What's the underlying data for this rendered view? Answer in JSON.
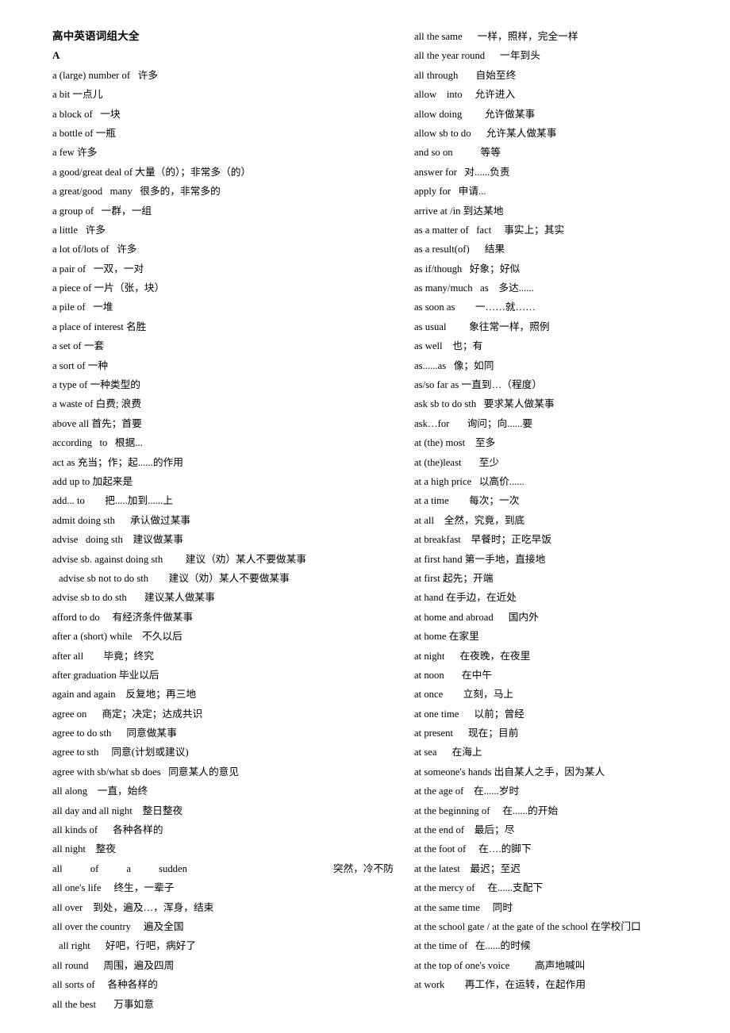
{
  "document": {
    "title": "高中英语词组大全",
    "section_letter": "A",
    "background_color": "#ffffff",
    "text_color": "#000000"
  },
  "left_column": [
    {
      "term": "a (large) number of",
      "gloss": "许多",
      "sep": "   "
    },
    {
      "term": "a bit",
      "gloss": "一点儿",
      "sep": " "
    },
    {
      "term": "a block of",
      "gloss": "一块",
      "sep": "   "
    },
    {
      "term": "a bottle of",
      "gloss": "一瓶",
      "sep": " "
    },
    {
      "term": "a few",
      "gloss": "许多",
      "sep": " "
    },
    {
      "term": "a good/great deal of",
      "gloss": "大量（的）；非常多（的）",
      "sep": " "
    },
    {
      "term": "a great/good   many",
      "gloss": "很多的，非常多的",
      "sep": "   "
    },
    {
      "term": "a group of",
      "gloss": "一群，一组",
      "sep": "   "
    },
    {
      "term": "a little",
      "gloss": "许多",
      "sep": "   "
    },
    {
      "term": "a lot of/lots of",
      "gloss": "许多",
      "sep": "   "
    },
    {
      "term": "a pair of",
      "gloss": "一双，一对",
      "sep": "   "
    },
    {
      "term": "a piece of",
      "gloss": "一片（张，块）",
      "sep": " "
    },
    {
      "term": "a pile of",
      "gloss": "一堆",
      "sep": "   "
    },
    {
      "term": "a place of interest",
      "gloss": "名胜",
      "sep": " "
    },
    {
      "term": "a set of",
      "gloss": "一套",
      "sep": " "
    },
    {
      "term": "a sort of",
      "gloss": "一种",
      "sep": " "
    },
    {
      "term": "a type of",
      "gloss": "一种类型的",
      "sep": " "
    },
    {
      "term": "a waste of",
      "gloss": "白费; 浪费",
      "sep": " "
    },
    {
      "term": "above all",
      "gloss": "首先；首要",
      "sep": " "
    },
    {
      "term": "according   to",
      "gloss": "根据...",
      "sep": "   "
    },
    {
      "term": "act as",
      "gloss": "充当；作；起......的作用",
      "sep": " "
    },
    {
      "term": "add up to",
      "gloss": "加起来是",
      "sep": " "
    },
    {
      "term": "add... to",
      "gloss": "把.....加到......上",
      "sep": "        "
    },
    {
      "term": "admit doing sth",
      "gloss": "承认做过某事",
      "sep": "      "
    },
    {
      "term": "advise   doing sth",
      "gloss": "建议做某事",
      "sep": "    "
    },
    {
      "term": "advise sb. against doing sth",
      "gloss": "建议（劝）某人不要做某事",
      "sep": "         "
    },
    {
      "term": "advise sb not to do sth",
      "gloss": "建议（劝）某人不要做某事",
      "sep": "        ",
      "indent": true
    },
    {
      "term": "advise sb to do sth",
      "gloss": "建议某人做某事",
      "sep": "       "
    },
    {
      "term": "afford to do",
      "gloss": "有经济条件做某事",
      "sep": "     "
    },
    {
      "term": "after a (short) while",
      "gloss": "不久以后",
      "sep": "    "
    },
    {
      "term": "after all",
      "gloss": "毕竟；终究",
      "sep": "        "
    },
    {
      "term": "after graduation",
      "gloss": "毕业以后",
      "sep": " "
    },
    {
      "term": "again and again",
      "gloss": "反复地；再三地",
      "sep": "    "
    },
    {
      "term": "agree on",
      "gloss": "商定；决定；达成共识",
      "sep": "      "
    },
    {
      "term": "agree to do sth",
      "gloss": "同意做某事",
      "sep": "      "
    },
    {
      "term": "agree to sth",
      "gloss": "同意(计划或建议)",
      "sep": "     "
    },
    {
      "term": "agree with sb/what sb does",
      "gloss": "同意某人的意见",
      "sep": "   "
    },
    {
      "term": "all along",
      "gloss": "一直，始终",
      "sep": "    "
    },
    {
      "term": "all day and all night",
      "gloss": "整日整夜",
      "sep": "    "
    },
    {
      "term": "all kinds of",
      "gloss": "各种各样的",
      "sep": "      "
    },
    {
      "term": "all night",
      "gloss": "整夜",
      "sep": "    "
    },
    {
      "term": "all    of    a    sudden",
      "gloss": "突然，冷不防",
      "sep": "",
      "justified": true
    },
    {
      "term": "all one's life",
      "gloss": "终生，一辈子",
      "sep": "     "
    },
    {
      "term": "all over",
      "gloss": "到处，遍及…，浑身，结束",
      "sep": "    "
    },
    {
      "term": "all over the country",
      "gloss": "遍及全国",
      "sep": "     "
    },
    {
      "term": "all right",
      "gloss": "好吧，行吧，病好了",
      "sep": "      ",
      "indent": true
    },
    {
      "term": "all round",
      "gloss": "周围，遍及四周",
      "sep": "      "
    },
    {
      "term": "all sorts of",
      "gloss": "各种各样的",
      "sep": "     "
    },
    {
      "term": "all the best",
      "gloss": "万事如意",
      "sep": "       "
    }
  ],
  "right_column": [
    {
      "term": "all the same",
      "gloss": "一样，照样，完全一样",
      "sep": "      "
    },
    {
      "term": "all the year round",
      "gloss": "一年到头",
      "sep": "      "
    },
    {
      "term": "all through",
      "gloss": "自始至终",
      "sep": "       "
    },
    {
      "term": "allow    into",
      "gloss": "允许进入",
      "sep": "     "
    },
    {
      "term": "allow doing",
      "gloss": "允许做某事",
      "sep": "         "
    },
    {
      "term": "allow sb to do",
      "gloss": "允许某人做某事",
      "sep": "      "
    },
    {
      "term": "and so on",
      "gloss": "等等",
      "sep": "           "
    },
    {
      "term": "answer for",
      "gloss": "对......负责",
      "sep": "   "
    },
    {
      "term": "apply for",
      "gloss": "申请...",
      "sep": "   "
    },
    {
      "term": "arrive at /in",
      "gloss": "到达某地",
      "sep": " "
    },
    {
      "term": "as a matter of   fact",
      "gloss": "事实上；其实",
      "sep": "     "
    },
    {
      "term": "as a result(of)",
      "gloss": "结果",
      "sep": "      "
    },
    {
      "term": "as if/though",
      "gloss": "好象；好似",
      "sep": "   "
    },
    {
      "term": "as many/much   as",
      "gloss": "多达......",
      "sep": "    "
    },
    {
      "term": "as soon as",
      "gloss": "一……就……",
      "sep": "        "
    },
    {
      "term": "as usual",
      "gloss": "象往常一样，照例",
      "sep": "         "
    },
    {
      "term": "as well",
      "gloss": "也；有",
      "sep": "    "
    },
    {
      "term": "as......as",
      "gloss": "像；如同",
      "sep": "   "
    },
    {
      "term": "as/so far as",
      "gloss": "一直到…（程度）",
      "sep": " "
    },
    {
      "term": "ask sb to do sth",
      "gloss": "要求某人做某事",
      "sep": "   "
    },
    {
      "term": "ask…for",
      "gloss": "询问；向......要",
      "sep": "       "
    },
    {
      "term": "at (the) most",
      "gloss": "至多",
      "sep": "    "
    },
    {
      "term": "at (the)least",
      "gloss": "至少",
      "sep": "       "
    },
    {
      "term": "at a high price",
      "gloss": "以高价......",
      "sep": "   "
    },
    {
      "term": "at a time",
      "gloss": "每次；一次",
      "sep": "        "
    },
    {
      "term": "at all",
      "gloss": "全然，究竟，到底",
      "sep": "    "
    },
    {
      "term": "at breakfast",
      "gloss": "早餐时；正吃早饭",
      "sep": "    "
    },
    {
      "term": "at first hand",
      "gloss": "第一手地，直接地",
      "sep": " "
    },
    {
      "term": "at first",
      "gloss": "起先；开端",
      "sep": " "
    },
    {
      "term": "at hand",
      "gloss": "在手边，在近处",
      "sep": " "
    },
    {
      "term": "at home and abroad",
      "gloss": "国内外",
      "sep": "      "
    },
    {
      "term": "at home",
      "gloss": "在家里",
      "sep": " "
    },
    {
      "term": "at night",
      "gloss": "在夜晚，在夜里",
      "sep": "      "
    },
    {
      "term": "at noon",
      "gloss": "在中午",
      "sep": "       "
    },
    {
      "term": "at once",
      "gloss": "立刻，马上",
      "sep": "        "
    },
    {
      "term": "at one time",
      "gloss": "以前；曾经",
      "sep": "      "
    },
    {
      "term": "at present",
      "gloss": "现在；目前",
      "sep": "      "
    },
    {
      "term": "at sea",
      "gloss": "在海上",
      "sep": "      "
    },
    {
      "term": "at someone's hands",
      "gloss": "出自某人之手，因为某人",
      "sep": " "
    },
    {
      "term": "at the age of",
      "gloss": "在......岁时",
      "sep": "    "
    },
    {
      "term": "at the beginning of",
      "gloss": "在......的开始",
      "sep": "     "
    },
    {
      "term": "at the end of",
      "gloss": "最后；尽",
      "sep": "    "
    },
    {
      "term": "at the foot of",
      "gloss": "在….的脚下",
      "sep": "     "
    },
    {
      "term": "at the latest",
      "gloss": "最迟；至迟",
      "sep": "    "
    },
    {
      "term": "at the mercy of",
      "gloss": "在......支配下",
      "sep": "     "
    },
    {
      "term": "at the same time",
      "gloss": "同时",
      "sep": "     "
    },
    {
      "term": "at the school gate / at the gate of the school",
      "gloss": "在学校门口",
      "sep": " "
    },
    {
      "term": "at the time of",
      "gloss": "在......的时候",
      "sep": "   "
    },
    {
      "term": "at the top of one's voice",
      "gloss": "高声地喊叫",
      "sep": "          "
    },
    {
      "term": "at work",
      "gloss": "再工作，在运转，在起作用",
      "sep": "        "
    }
  ]
}
